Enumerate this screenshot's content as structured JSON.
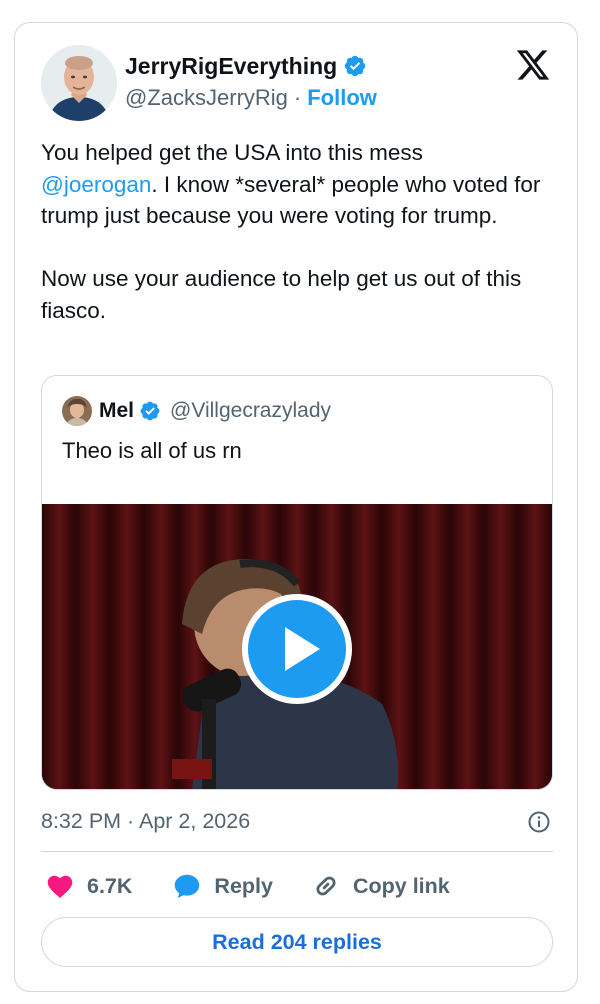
{
  "author": {
    "display_name": "JerryRigEverything",
    "handle": "@ZacksJerryRig",
    "separator": "·",
    "follow_label": "Follow",
    "verified": true
  },
  "tweet": {
    "text_part1": "You helped get the USA into this mess\n",
    "mention": "@joerogan",
    "text_part2": ". I know *several* people who voted for trump just because you were voting for trump.\n\nNow use your audience to help get us out of this fiasco."
  },
  "quote": {
    "display_name": "Mel",
    "handle": "@Villgecrazylady",
    "text": "Theo is all of us rn",
    "media_type": "video"
  },
  "timestamp": "8:32 PM · Apr 2, 2026",
  "actions": {
    "like_count": "6.7K",
    "reply_label": "Reply",
    "copy_label": "Copy link"
  },
  "read_replies_label": "Read 204 replies",
  "colors": {
    "accent": "#1d9bf0",
    "like": "#f91880",
    "text": "#0f1419",
    "secondary": "#536471",
    "border": "#cfd9de"
  },
  "icons": [
    "x-logo-icon",
    "verified-badge-icon",
    "play-icon",
    "info-icon",
    "heart-icon",
    "reply-icon",
    "link-icon"
  ]
}
